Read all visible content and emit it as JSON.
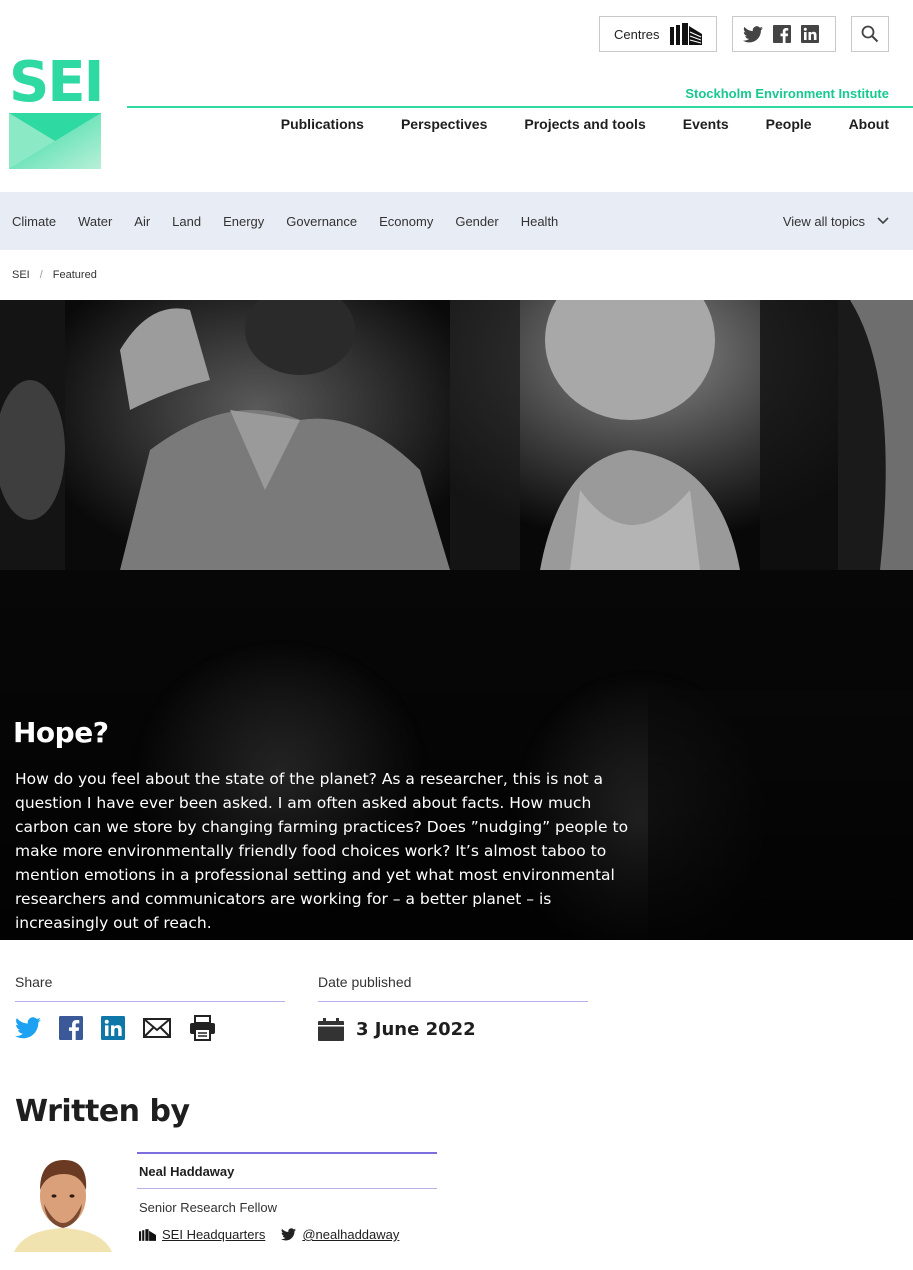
{
  "header": {
    "logo_text": "SEI",
    "org_name": "Stockholm Environment Institute",
    "centres_label": "Centres",
    "nav": [
      "Publications",
      "Perspectives",
      "Projects and tools",
      "Events",
      "People",
      "About"
    ],
    "brand_color": "#2fd9a2"
  },
  "topics": {
    "items": [
      "Climate",
      "Water",
      "Air",
      "Land",
      "Energy",
      "Governance",
      "Economy",
      "Gender",
      "Health"
    ],
    "view_all": "View all topics"
  },
  "breadcrumb": [
    "SEI",
    "Featured"
  ],
  "hero": {
    "title": "Hope?",
    "text": "How do you feel about the state of the planet? As a researcher, this is not a question I have ever been asked. I am often asked about facts. How much carbon can we store by changing farming practices? Does ”nudging” people to make more environmentally friendly food choices work? It’s almost taboo to mention emotions in a professional setting and yet what most environmental researchers and communicators are working for – a better planet – is increasingly out of reach."
  },
  "meta": {
    "share_label": "Share",
    "date_label": "Date published",
    "date_value": "3 June 2022"
  },
  "written_by": {
    "heading": "Written by",
    "author": {
      "name": "Neal Haddaway",
      "role": "Senior Research Fellow",
      "centre": "SEI Headquarters",
      "twitter": "@nealhaddaway"
    }
  }
}
